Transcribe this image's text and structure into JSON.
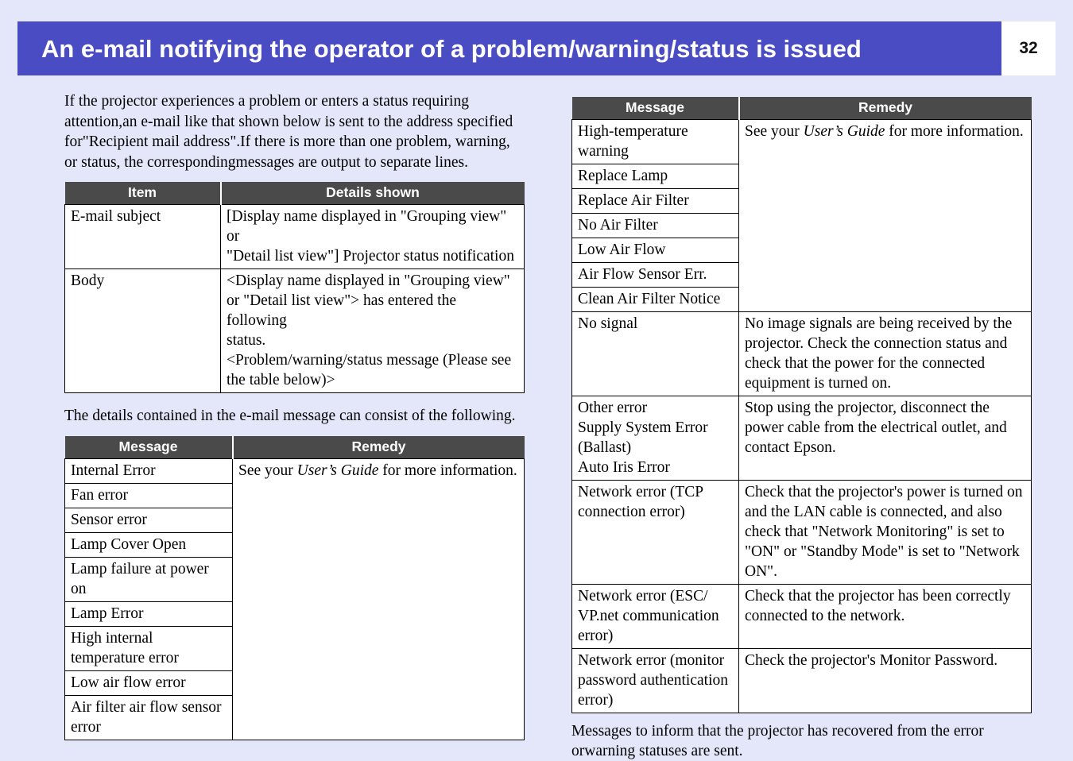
{
  "header": {
    "title": "An e-mail notifying the operator of a problem/warning/status is issued",
    "page_number": "32",
    "banner_color": "#4a4cc4",
    "page_background": "#e3e7f9"
  },
  "left_column": {
    "intro_paragraph": "If the projector experiences a problem or enters a status requiring attention, an e-mail like that shown below is sent to the address specified for \"Recipient mail address\".\nIf there is more than one problem, warning, or status, the corresponding messages are output to separate lines.",
    "intro_lines": [
      "If the projector experiences a problem or enters a status requiring attention,",
      "an e-mail like that shown below is sent to the address specified for",
      "\"Recipient mail address\".",
      "If there is more than one problem, warning, or status, the corresponding",
      "messages are output to separate lines."
    ],
    "item_table": {
      "headers": [
        "Item",
        "Details shown"
      ],
      "rows": [
        {
          "item": "E-mail subject",
          "details_lines": [
            "[Display name displayed in \"Grouping view\" or",
            "\"Detail list view\"] Projector status notification"
          ]
        },
        {
          "item": "Body",
          "details_lines": [
            "<Display name displayed in \"Grouping view\"",
            "or \"Detail list view\"> has entered the following",
            "status.",
            "<Problem/warning/status message (Please see",
            "the table below)>"
          ]
        }
      ]
    },
    "details_paragraph": "The details contained in the e-mail message can consist of the following.",
    "message_table": {
      "headers": [
        "Message",
        "Remedy"
      ],
      "remedy_prefix": "See your ",
      "remedy_italic": "User’s Guide",
      "remedy_suffix": " for more information.",
      "messages": [
        "Internal Error",
        "Fan error",
        "Sensor error",
        "Lamp Cover Open",
        "Lamp failure at power on",
        "Lamp Error",
        "High internal\ntemperature error",
        "Low air flow error",
        "Air filter air flow sensor\nerror"
      ]
    }
  },
  "right_column": {
    "message_table": {
      "headers": [
        "Message",
        "Remedy"
      ],
      "group1": {
        "messages": [
          "High-temperature\nwarning",
          "Replace Lamp",
          "Replace Air Filter",
          "No Air Filter",
          "Low Air Flow",
          "Air Flow Sensor Err.",
          "Clean Air Filter Notice"
        ],
        "remedy_prefix": "See your ",
        "remedy_italic": "User’s Guide",
        "remedy_suffix": " for more information."
      },
      "rows": [
        {
          "message_lines": [
            "No signal"
          ],
          "remedy_lines": [
            "No image signals are being received by the",
            "projector. Check the connection status and",
            "check that the power for the connected",
            "equipment is turned on."
          ]
        },
        {
          "message_lines": [
            "Other error",
            "Supply System Error",
            "(Ballast)",
            "Auto Iris Error"
          ],
          "remedy_lines": [
            "Stop using the projector, disconnect the",
            "power cable from the electrical outlet, and",
            "contact Epson."
          ]
        },
        {
          "message_lines": [
            "Network error (TCP",
            "connection error)"
          ],
          "remedy_lines": [
            "Check that the projector's power is turned on",
            "and the LAN cable is connected, and also",
            "check that \"Network Monitoring\" is set to",
            "\"ON\" or \"Standby Mode\" is set to \"Network",
            "ON\"."
          ]
        },
        {
          "message_lines": [
            "Network error (ESC/",
            "VP.net communication",
            "error)"
          ],
          "remedy_lines": [
            "Check that the projector has been correctly",
            "connected to the network."
          ]
        },
        {
          "message_lines": [
            "Network error (monitor",
            "password authentication",
            "error)"
          ],
          "remedy_lines": [
            "Check the projector's Monitor Password."
          ]
        }
      ]
    },
    "footnote_lines": [
      "Messages to inform that the projector has recovered from the error or",
      "warning statuses are sent."
    ]
  }
}
